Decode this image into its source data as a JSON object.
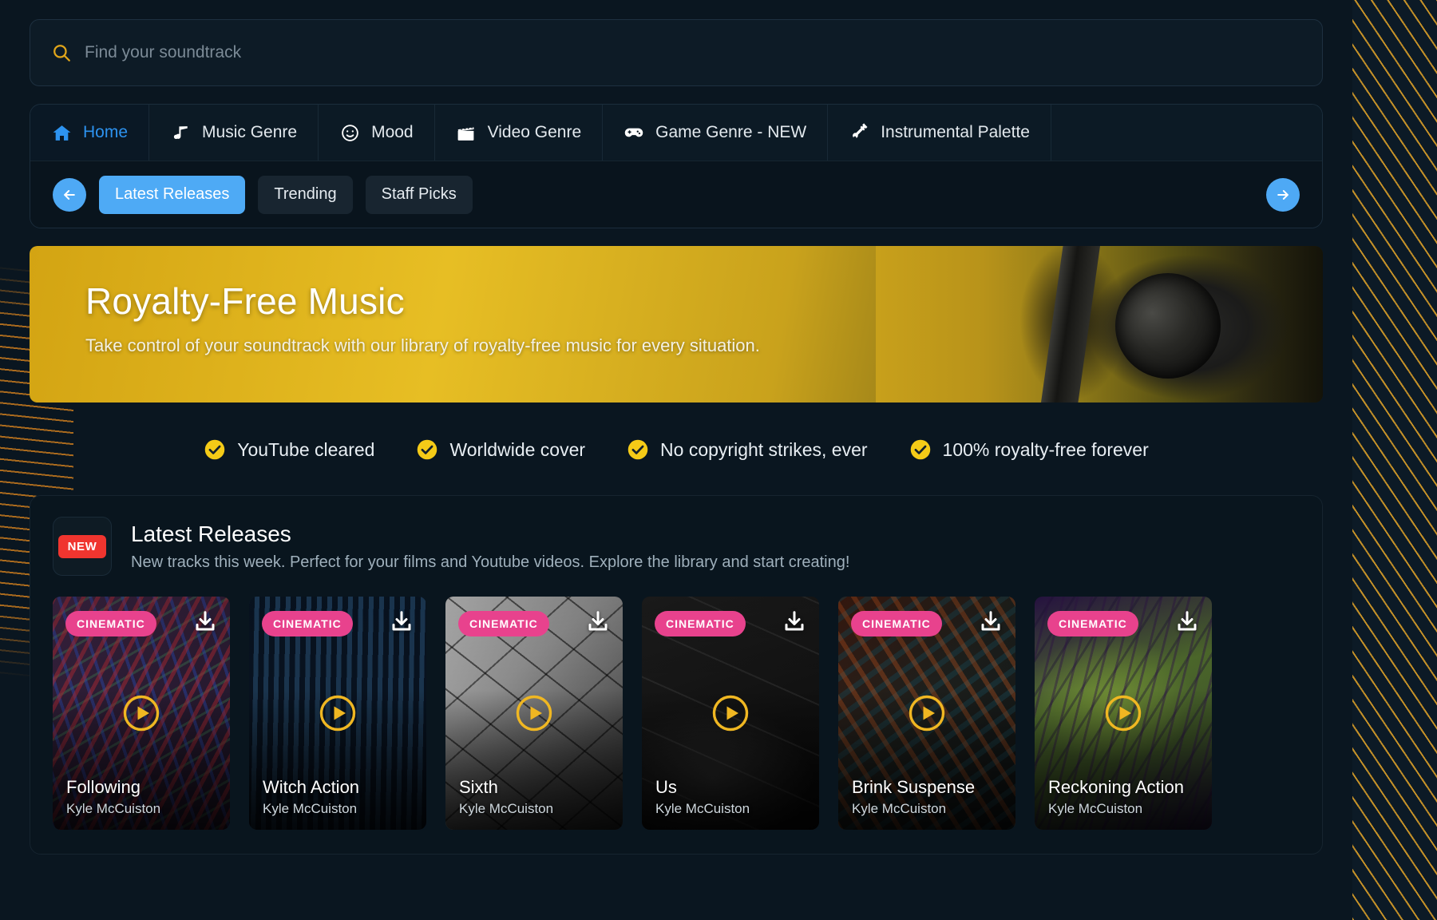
{
  "search": {
    "placeholder": "Find your soundtrack",
    "value": "",
    "icon": "search-icon"
  },
  "nav": {
    "tabs": [
      {
        "label": "Home",
        "icon": "home-icon",
        "active": true
      },
      {
        "label": "Music Genre",
        "icon": "music-note-icon",
        "active": false
      },
      {
        "label": "Mood",
        "icon": "smiley-icon",
        "active": false
      },
      {
        "label": "Video Genre",
        "icon": "clapperboard-icon",
        "active": false
      },
      {
        "label": "Game Genre - NEW",
        "icon": "gamepad-icon",
        "active": false
      },
      {
        "label": "Instrumental Palette",
        "icon": "guitar-icon",
        "active": false
      }
    ],
    "prev_label": "Previous",
    "next_label": "Next",
    "pills": [
      {
        "label": "Latest Releases",
        "active": true
      },
      {
        "label": "Trending",
        "active": false
      },
      {
        "label": "Staff Picks",
        "active": false
      }
    ]
  },
  "hero": {
    "title": "Royalty-Free Music",
    "subtitle": "Take control of your soundtrack with our library of royalty-free music for every situation."
  },
  "features": [
    {
      "label": "YouTube cleared"
    },
    {
      "label": "Worldwide cover"
    },
    {
      "label": "No copyright strikes, ever"
    },
    {
      "label": "100% royalty-free forever"
    }
  ],
  "section": {
    "badge": "NEW",
    "title": "Latest Releases",
    "description": "New tracks this week. Perfect for your films and Youtube videos. Explore the library and start creating!"
  },
  "cards": [
    {
      "tag": "CINEMATIC",
      "title": "Following",
      "artist": "Kyle McCuiston",
      "art": "art-following"
    },
    {
      "tag": "CINEMATIC",
      "title": "Witch Action",
      "artist": "Kyle McCuiston",
      "art": "art-witch"
    },
    {
      "tag": "CINEMATIC",
      "title": "Sixth",
      "artist": "Kyle McCuiston",
      "art": "art-sixth"
    },
    {
      "tag": "CINEMATIC",
      "title": "Us",
      "artist": "Kyle McCuiston",
      "art": "art-us"
    },
    {
      "tag": "CINEMATIC",
      "title": "Brink Suspense",
      "artist": "Kyle McCuiston",
      "art": "art-brink"
    },
    {
      "tag": "CINEMATIC",
      "title": "Reckoning Action",
      "artist": "Kyle McCuiston",
      "art": "art-reckoning"
    }
  ],
  "colors": {
    "accent_blue": "#4eaaf5",
    "accent_yellow": "#f0b722",
    "tag_pink": "#e8428d",
    "badge_red": "#f0352f",
    "background": "#0a1620",
    "panel": "#0d1b26"
  }
}
